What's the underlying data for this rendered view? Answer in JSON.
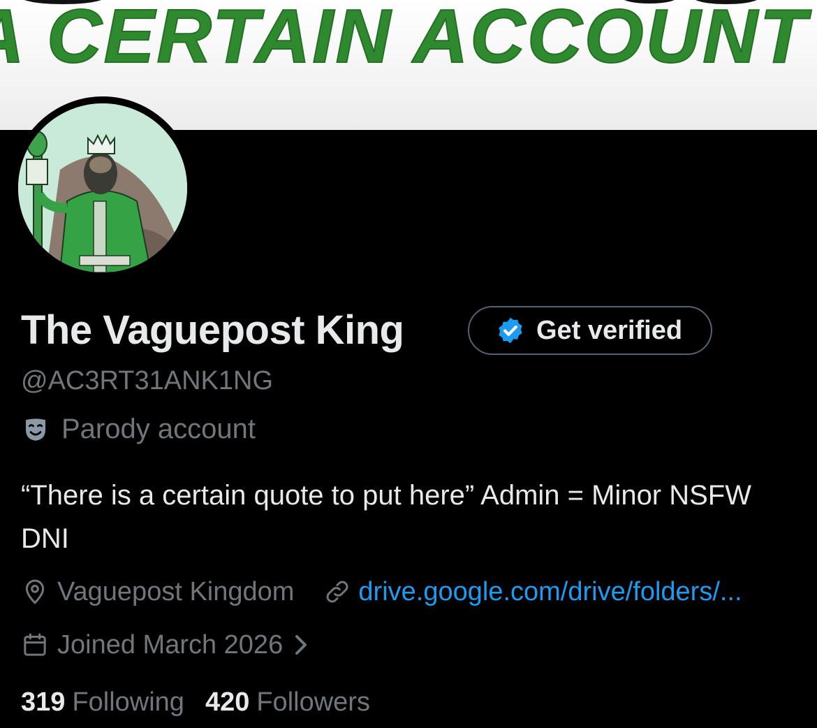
{
  "banner": {
    "text": "A CERTAIN ACCOUNT"
  },
  "profile": {
    "display_name": "The Vaguepost King",
    "handle": "@AC3RT31ANK1NG",
    "parody_label": "Parody account",
    "bio": "“There is a certain quote to put here” Admin = Minor NSFW DNI",
    "location": "Vaguepost Kingdom",
    "link": "drive.google.com/drive/folders/...",
    "joined": "Joined March 2026"
  },
  "verify_button": {
    "label": "Get verified"
  },
  "stats": {
    "following_count": "319",
    "following_label": "Following",
    "followers_count": "420",
    "followers_label": "Followers"
  },
  "colors": {
    "background": "#000000",
    "primary_text": "#e7e9ea",
    "secondary_text": "#71767b",
    "link": "#1d9bf0",
    "verified_badge": "#1d9bf0",
    "banner_text": "#2f8a2f"
  },
  "icons": {
    "verified": "verified-badge-icon",
    "parody": "theater-mask-icon",
    "location": "location-pin-icon",
    "link": "link-icon",
    "calendar": "calendar-icon",
    "chevron": "chevron-right-icon"
  }
}
